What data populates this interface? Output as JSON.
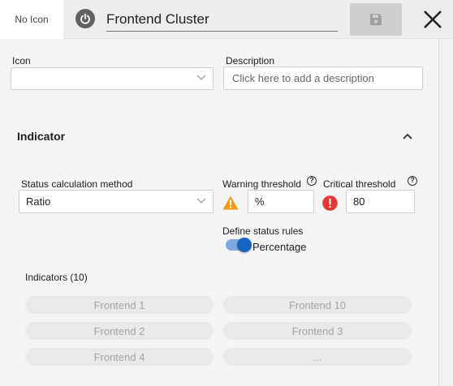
{
  "header": {
    "no_icon_label": "No Icon",
    "title_value": "Frontend Cluster"
  },
  "icon_field": {
    "label": "Icon",
    "value": ""
  },
  "description_field": {
    "label": "Description",
    "placeholder": "Click here to add a description"
  },
  "indicator_section": {
    "title": "Indicator",
    "status_method": {
      "label": "Status calculation method",
      "value": "Ratio"
    },
    "warning": {
      "label": "Warning threshold",
      "value": "%"
    },
    "critical": {
      "label": "Critical threshold",
      "value": "80"
    },
    "status_rules": {
      "label": "Define status rules",
      "toggle_label": "Percentage",
      "enabled": true
    }
  },
  "indicators": {
    "heading": "Indicators (10)",
    "items": [
      "Frontend 1",
      "Frontend 10",
      "Frontend 2",
      "Frontend 3",
      "Frontend 4",
      "..."
    ]
  },
  "colors": {
    "accent": "#1565c0",
    "warning": "#f29b1d",
    "critical": "#e53935"
  }
}
